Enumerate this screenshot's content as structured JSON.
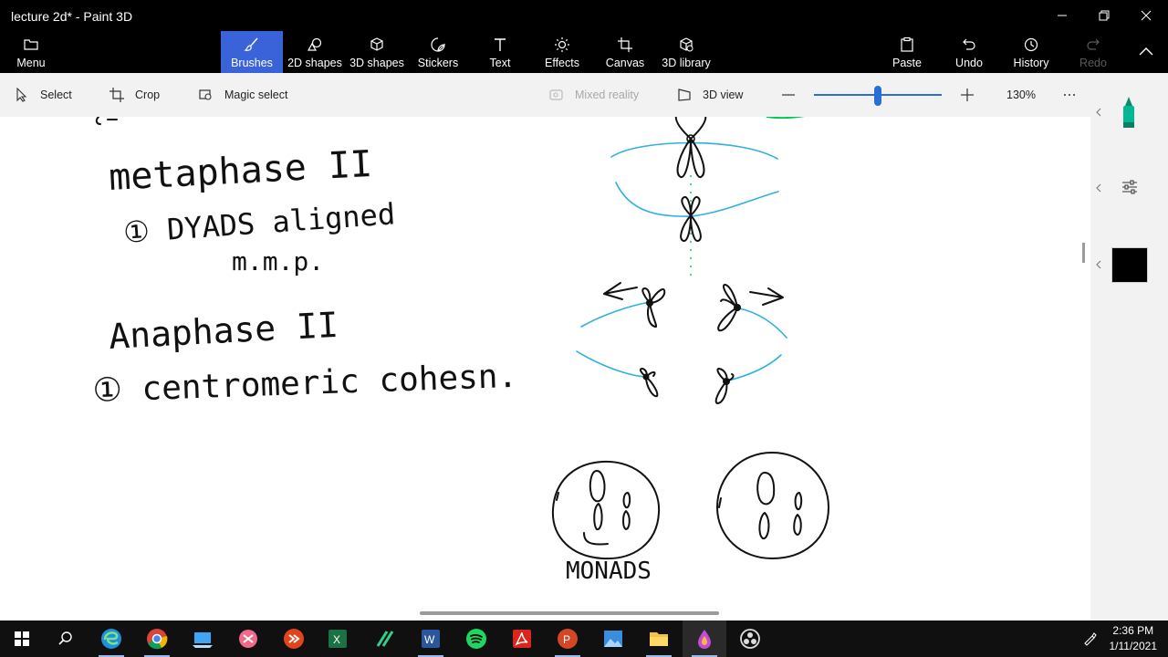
{
  "window": {
    "title": "lecture 2d* - Paint 3D"
  },
  "ribbon": {
    "menu": "Menu",
    "tools": [
      "Brushes",
      "2D shapes",
      "3D shapes",
      "Stickers",
      "Text",
      "Effects",
      "Canvas",
      "3D library"
    ],
    "paste": "Paste",
    "undo": "Undo",
    "history": "History",
    "redo": "Redo"
  },
  "subbar": {
    "select": "Select",
    "crop": "Crop",
    "magic_select": "Magic select",
    "mixed_reality": "Mixed reality",
    "view_3d": "3D view",
    "zoom": "130%",
    "zoom_level": 0.5
  },
  "canvas_notes": {
    "metaphase_title": "metaphase II",
    "metaphase_point": "① DYADS aligned",
    "metaphase_sub": "m.m.p.",
    "anaphase_title": "Anaphase II",
    "anaphase_point": "① centromeric cohesn.",
    "monads_label": "MONADS"
  },
  "colors": {
    "accent": "#3a63d9",
    "ink": "#111111",
    "spindle": "#2eb0e0",
    "selected_color": "#000000",
    "brush_color": "#00a88a"
  },
  "taskbar": {
    "time": "2:36 PM",
    "date": "1/11/2021",
    "apps": [
      "windows-start",
      "search",
      "edge",
      "chrome",
      "file-manager",
      "snipping",
      "remote",
      "excel",
      "editor",
      "word",
      "spotify",
      "acrobat",
      "powerpoint",
      "photos",
      "explorer",
      "paint3d",
      "obs"
    ]
  }
}
